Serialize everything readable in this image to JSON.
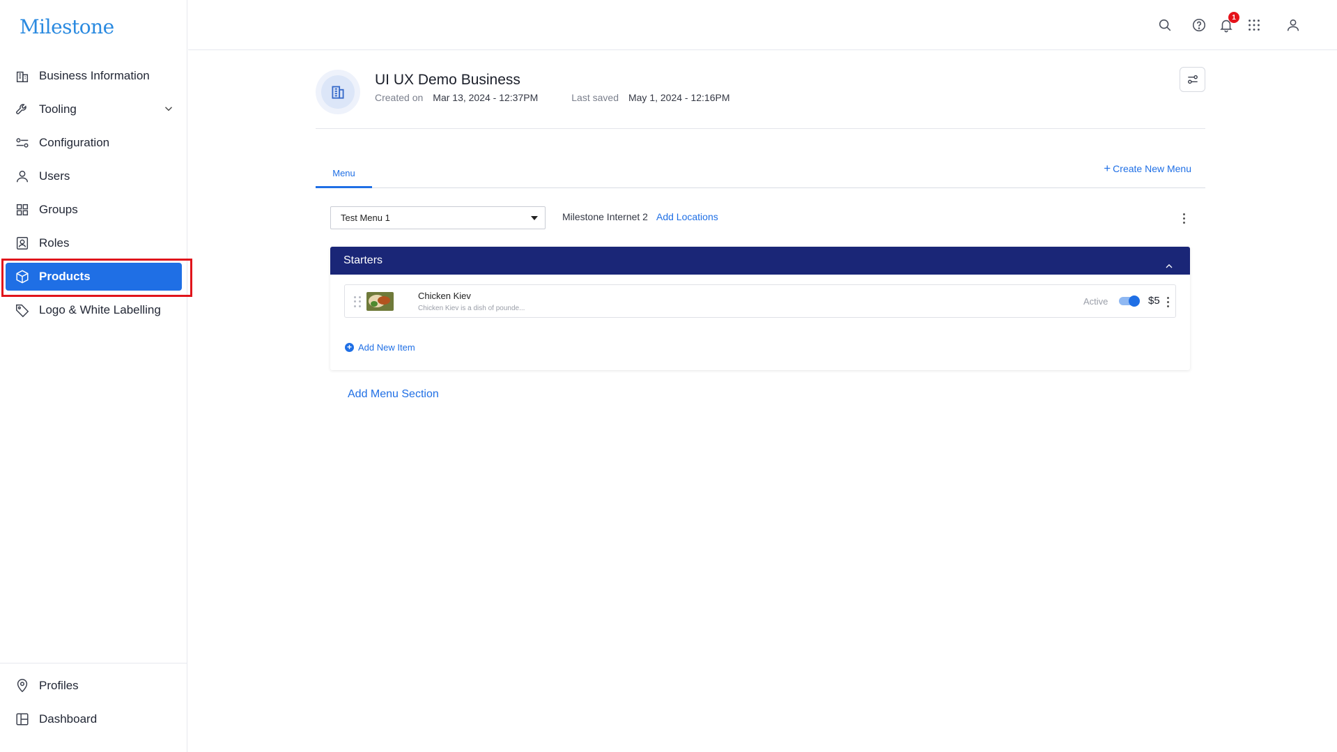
{
  "app": {
    "logo_text": "Milestone",
    "brand_color": "#1f6fe5",
    "section_header_color": "#1a2677",
    "highlight_color": "#e0141b"
  },
  "sidebar": {
    "items": [
      {
        "label": "Business Information",
        "icon": "building-icon"
      },
      {
        "label": "Tooling",
        "icon": "wrench-icon",
        "expandable": true
      },
      {
        "label": "Configuration",
        "icon": "sliders-icon"
      },
      {
        "label": "Users",
        "icon": "user-icon"
      },
      {
        "label": "Groups",
        "icon": "grid-icon"
      },
      {
        "label": "Roles",
        "icon": "id-badge-icon"
      },
      {
        "label": "Products",
        "icon": "box-icon",
        "active": true
      },
      {
        "label": "Logo & White Labelling",
        "icon": "tag-icon"
      }
    ],
    "bottom_items": [
      {
        "label": "Profiles",
        "icon": "map-pin-icon"
      },
      {
        "label": "Dashboard",
        "icon": "dashboard-icon"
      }
    ]
  },
  "topbar": {
    "icons": [
      "search-icon",
      "help-icon",
      "bell-icon",
      "apps-grid-icon",
      "account-icon"
    ],
    "notification_count": "1"
  },
  "business": {
    "name": "UI UX Demo Business",
    "created_label": "Created on",
    "created_value": "Mar 13, 2024 - 12:37PM",
    "saved_label": "Last saved",
    "saved_value": "May 1, 2024 - 12:16PM"
  },
  "tabs": {
    "active": "Menu",
    "create_label": "Create New Menu"
  },
  "menu_bar": {
    "selected_menu": "Test Menu 1",
    "location": "Milestone Internet 2",
    "add_locations_label": "Add Locations"
  },
  "section": {
    "title": "Starters",
    "items": [
      {
        "name": "Chicken Kiev",
        "description": "Chicken Kiev is a dish of pounde...",
        "status": "Active",
        "active": true,
        "price": "$5"
      }
    ],
    "add_item_label": "Add New Item"
  },
  "add_section_label": "Add Menu Section"
}
